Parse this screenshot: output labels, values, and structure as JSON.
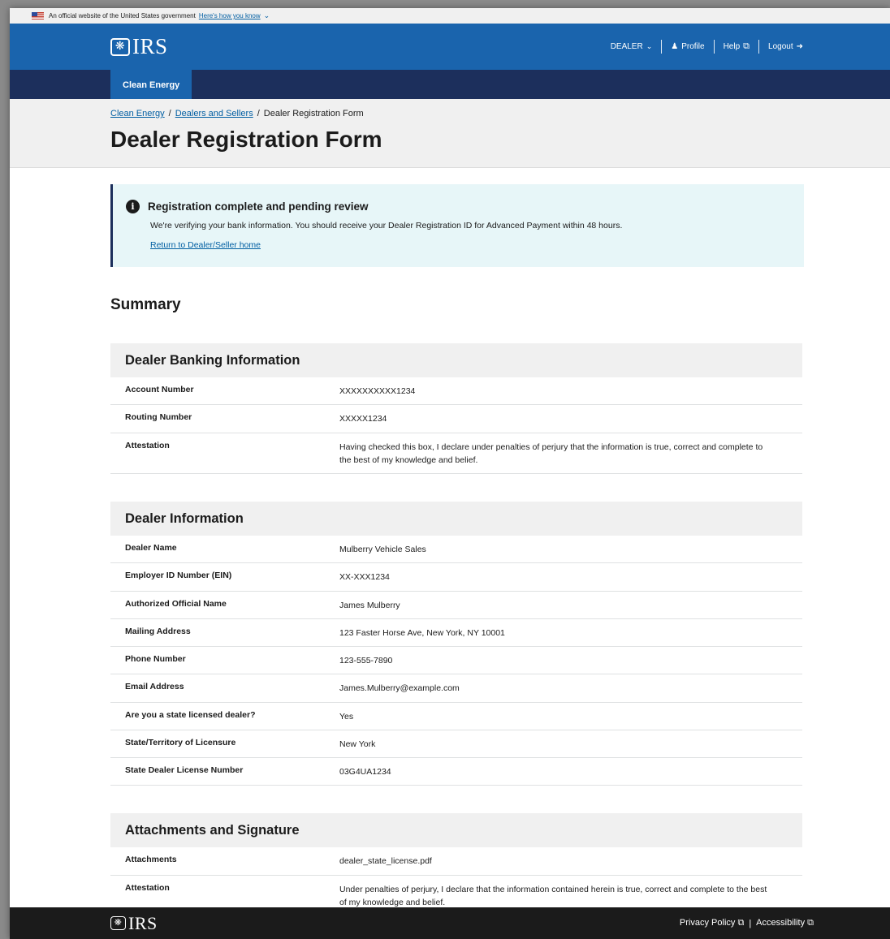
{
  "gov_banner": {
    "text": "An official website of the United States government",
    "link": "Here's how you know"
  },
  "header": {
    "logo_text": "IRS",
    "nav": {
      "dealer": "DEALER",
      "profile": "Profile",
      "help": "Help",
      "logout": "Logout"
    }
  },
  "subnav": {
    "tab": "Clean Energy"
  },
  "breadcrumb": {
    "items": [
      "Clean Energy",
      "Dealers and Sellers"
    ],
    "current": "Dealer Registration Form"
  },
  "page_title": "Dealer Registration Form",
  "alert": {
    "title": "Registration complete and pending review",
    "body": "We're verifying your bank information. You should receive your Dealer Registration ID for Advanced Payment within 48 hours.",
    "link": "Return to Dealer/Seller home"
  },
  "summary_title": "Summary",
  "sections": [
    {
      "title": "Dealer Banking Information",
      "rows": [
        {
          "label": "Account Number",
          "value": "XXXXXXXXXX1234"
        },
        {
          "label": "Routing Number",
          "value": "XXXXX1234"
        },
        {
          "label": "Attestation",
          "value": "Having checked this box, I declare under penalties of perjury that the information is true, correct and complete to the best of my knowledge and belief."
        }
      ]
    },
    {
      "title": "Dealer Information",
      "rows": [
        {
          "label": "Dealer Name",
          "value": "Mulberry Vehicle Sales"
        },
        {
          "label": "Employer ID Number (EIN)",
          "value": "XX-XXX1234"
        },
        {
          "label": "Authorized Official Name",
          "value": "James Mulberry"
        },
        {
          "label": "Mailing Address",
          "value": "123 Faster Horse Ave, New York, NY 10001"
        },
        {
          "label": "Phone Number",
          "value": "123-555-7890"
        },
        {
          "label": "Email Address",
          "value": "James.Mulberry@example.com"
        },
        {
          "label": "Are you a state licensed dealer?",
          "value": "Yes"
        },
        {
          "label": "State/Territory of Licensure",
          "value": "New York"
        },
        {
          "label": "State Dealer License Number",
          "value": "03G4UA1234"
        }
      ]
    },
    {
      "title": "Attachments and Signature",
      "rows": [
        {
          "label": "Attachments",
          "value": "dealer_state_license.pdf"
        },
        {
          "label": "Attestation",
          "value": "Under penalties of perjury, I declare that the information contained herein is true, correct and complete to the best of my knowledge and belief."
        }
      ]
    }
  ],
  "footer": {
    "logo_text": "IRS",
    "links": [
      "Privacy Policy",
      "Accessibility"
    ],
    "separator": "|"
  }
}
